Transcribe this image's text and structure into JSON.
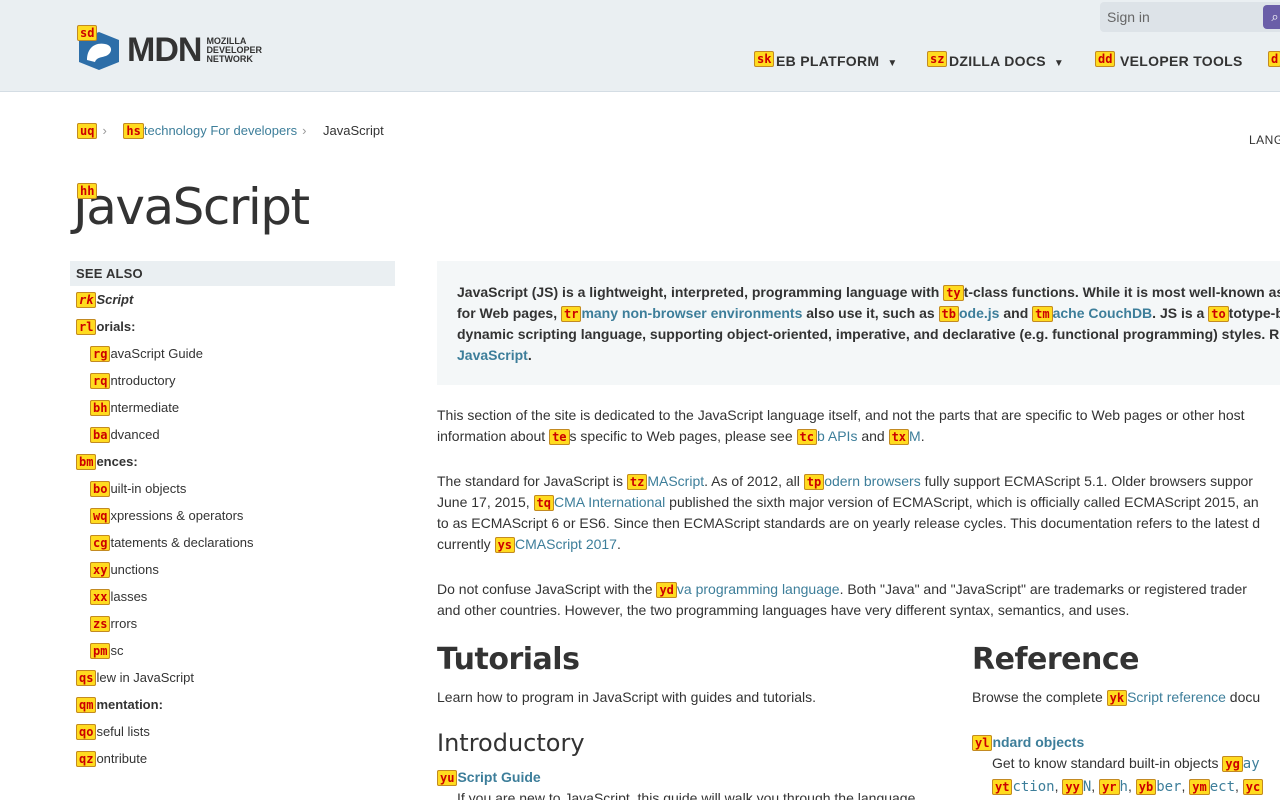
{
  "header": {
    "logo_word": "MDN",
    "logo_sub": [
      "MOZILLA",
      "DEVELOPER",
      "NETWORK"
    ],
    "search_placeholder": "Sign in",
    "nav": [
      {
        "label": "EB PLATFORM",
        "hint": "sk"
      },
      {
        "label": "DZILLA DOCS",
        "hint": "sz"
      },
      {
        "label": "VELOPER TOOLS",
        "hint": "dd"
      }
    ]
  },
  "breadcrumbs": {
    "item1_hint": "uq",
    "item2_hint": "hs",
    "item2_label": "technology For developers",
    "current": "JavaScript"
  },
  "lang_label": "LANG",
  "page_title": "JavaScript",
  "page_title_hint": "hh",
  "sidebar": {
    "heading": "SEE ALSO",
    "items": [
      {
        "hint": "rk",
        "label": "Script"
      },
      {
        "hint": "rl",
        "label": "orials:"
      },
      {
        "hint": "rg",
        "label": "avaScript Guide"
      },
      {
        "hint": "rq",
        "label": "ntroductory"
      },
      {
        "hint": "bh",
        "label": "ntermediate"
      },
      {
        "hint": "ba",
        "label": "dvanced"
      },
      {
        "hint": "bm",
        "label": "ences:"
      },
      {
        "hint": "bo",
        "label": "uilt-in objects"
      },
      {
        "hint": "wq",
        "label": "xpressions & operators"
      },
      {
        "hint": "cg",
        "label": "tatements & declarations"
      },
      {
        "hint": "xy",
        "label": "unctions"
      },
      {
        "hint": "xx",
        "label": "lasses"
      },
      {
        "hint": "zs",
        "label": "rrors"
      },
      {
        "hint": "pm",
        "label": "sc"
      },
      {
        "hint": "qs",
        "label": "lew in JavaScript"
      },
      {
        "hint": "qm",
        "label": "mentation:"
      },
      {
        "hint": "qo",
        "label": "seful lists"
      },
      {
        "hint": "qz",
        "label": "ontribute"
      }
    ]
  },
  "summary": {
    "line1_a": "JavaScript (JS) is a lightweight, interpreted, programming language with ",
    "hint_ty": "ty",
    "line1_b": "t-class functions. While it is most well-known as",
    "line2_a": "for Web pages, ",
    "hint_tr": "tr",
    "link_nonbrowser": "many non-browser environments",
    "line2_b": " also use it, such as ",
    "hint_tb": "tb",
    "link_node": "ode.js",
    "line2_c": " and ",
    "hint_tm": "tm",
    "link_couch": "ache CouchDB",
    "line2_d": ". JS is a ",
    "hint_to": "to",
    "line2_e": "totype-b",
    "line3": "dynamic scripting language, supporting object-oriented, imperative, and declarative (e.g. functional programming) styles. R",
    "line4_link": "JavaScript",
    "line4_tail": "."
  },
  "para1": {
    "line1": "This section of the site is dedicated to the JavaScript language itself, and not the parts that are specific to Web pages or other host",
    "line2_a": "information about ",
    "hint_te": "te",
    "line2_b": "s specific to Web pages, please see ",
    "hint_tc": "tc",
    "link_webapis": "b APIs",
    "line2_c": " and ",
    "hint_tx": "tx",
    "link_dom": "M",
    "line2_d": "."
  },
  "para2": {
    "line1_a": "The standard for JavaScript is ",
    "hint_tz": "tz",
    "link_ecma": "MAScript",
    "line1_b": ". As of 2012, all ",
    "hint_tp": "tp",
    "link_browsers": "odern browsers",
    "line1_c": " fully support ECMAScript 5.1. Older browsers suppor",
    "line2_a": "June 17, 2015, ",
    "hint_tq": "tq",
    "link_intl": "CMA International",
    "line2_b": " published the sixth major version of ECMAScript, which is officially called ECMAScript 2015, an",
    "line3": "to as ECMAScript 6 or ES6. Since then ECMAScript standards are on yearly release cycles. This documentation refers to the latest d",
    "line4_a": "currently ",
    "hint_ys": "ys",
    "link_2017": "CMAScript 2017",
    "line4_b": "."
  },
  "para3": {
    "line1_a": "Do not confuse JavaScript with the ",
    "hint_yd": "yd",
    "link_java": "va programming language",
    "line1_b": ". Both \"Java\" and \"JavaScript\" are trademarks or registered trader",
    "line2": "and other countries. However, the two programming languages have very different syntax, semantics, and uses."
  },
  "tutorials": {
    "heading": "Tutorials",
    "desc": "Learn how to program in JavaScript with guides and tutorials.",
    "introductory": "Introductory",
    "hint_yu": "yu",
    "guide_link": "Script Guide",
    "guide_desc": "If you are new to JavaScript, this guide will walk you through the language."
  },
  "reference": {
    "heading": "Reference",
    "desc_a": "Browse the complete ",
    "hint_yk": "yk",
    "link": "Script reference",
    "desc_b": " docu",
    "hint_yl": "yl",
    "std_link": "ndard objects",
    "std_desc_a": "Get to know standard built-in objects ",
    "hint_yg": "yg",
    "std_tail": "ay",
    "objects": [
      {
        "hint": "yt",
        "label": "ction"
      },
      {
        "hint": "yy",
        "label": "N"
      },
      {
        "hint": "yr",
        "label": "h"
      },
      {
        "hint": "yb",
        "label": "ber"
      },
      {
        "hint": "ym",
        "label": "ect"
      },
      {
        "hint": "yc",
        "label": ""
      }
    ]
  }
}
